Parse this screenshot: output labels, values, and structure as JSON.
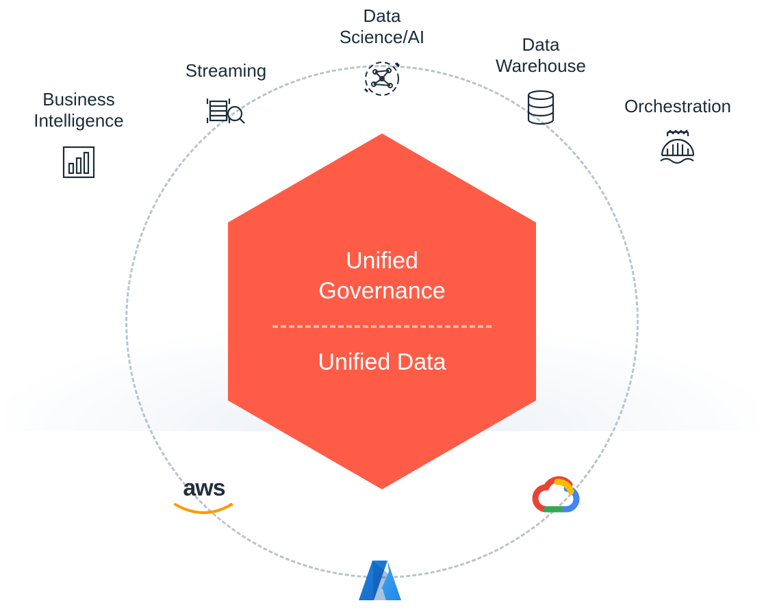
{
  "center": {
    "top_line1": "Unified",
    "top_line2": "Governance",
    "bottom": "Unified Data"
  },
  "categories": {
    "bi": {
      "line1": "Business",
      "line2": "Intelligence"
    },
    "streaming": {
      "label": "Streaming"
    },
    "dsai": {
      "line1": "Data",
      "line2": "Science/AI"
    },
    "dw": {
      "line1": "Data",
      "line2": "Warehouse"
    },
    "orchestration": {
      "label": "Orchestration"
    }
  },
  "clouds": {
    "aws": "aws",
    "azure": "Azure",
    "gcp": "Google Cloud"
  },
  "colors": {
    "hexagon": "#FF5C47",
    "text_dark": "#1b2b3a",
    "dash": "#b8c4d0"
  }
}
